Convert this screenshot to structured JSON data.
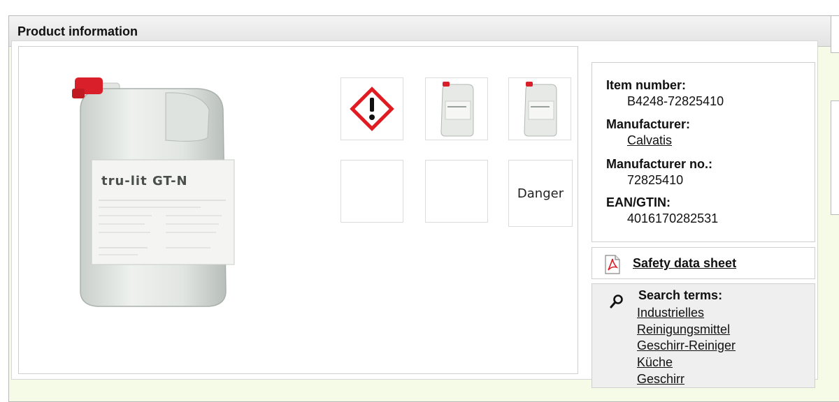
{
  "panel": {
    "title": "Product information"
  },
  "product": {
    "label_brand": "tru-lit GT-N"
  },
  "hazard": {
    "signal_word": "Danger",
    "pictogram": "exclamation-mark-hazard-icon"
  },
  "details": {
    "item_number_label": "Item number:",
    "item_number": "B4248-72825410",
    "manufacturer_label": "Manufacturer:",
    "manufacturer": "Calvatis",
    "manufacturer_no_label": "Manufacturer no.:",
    "manufacturer_no": "72825410",
    "ean_label": "EAN/GTIN:",
    "ean": "4016170282531"
  },
  "documents": {
    "sds_label": "Safety data sheet",
    "icon": "pdf-icon"
  },
  "search": {
    "label": "Search terms:",
    "icon": "search-icon",
    "terms": [
      "Industrielles",
      "Reinigungsmittel",
      "Geschirr-Reiniger",
      "Küche",
      "Geschirr"
    ]
  },
  "colors": {
    "panel_bg": "#f6fbe7",
    "cap_red": "#d9202a",
    "hazard_red": "#e01b22"
  }
}
